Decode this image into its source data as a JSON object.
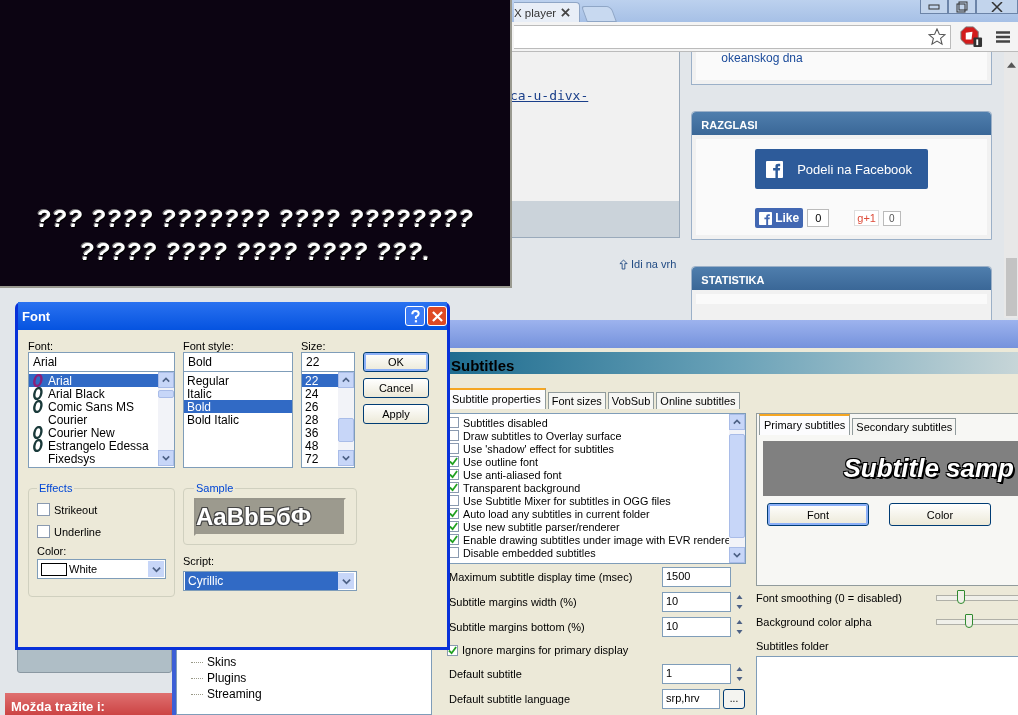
{
  "browser": {
    "tab": {
      "title": "X player"
    },
    "page": {
      "article_link": "ca-u-divx-",
      "related_link": "okeanskog dna",
      "back_to_top": "Idi na vrh",
      "razglasi": {
        "title": "RAZGLASI",
        "share_button": "Podeli na Facebook",
        "like": "Like",
        "like_count": "0",
        "plus_one": "g+1",
        "plus_one_count": "0"
      },
      "statistika": {
        "title": "STATISTIKA"
      },
      "suggestions": {
        "title": "Možda tražite i:"
      }
    }
  },
  "video": {
    "subtitle_lines": [
      "??? ???? ??????? ???? ????????",
      "????? ???? ???? ???? ???."
    ]
  },
  "options": {
    "tree": [
      {
        "label": "Skins"
      },
      {
        "label": "Plugins"
      },
      {
        "label": "Streaming"
      }
    ],
    "header": "Subtitles",
    "tabs": [
      {
        "label": "Subtitle properties",
        "selected": true
      },
      {
        "label": "Font sizes",
        "selected": false
      },
      {
        "label": "VobSub",
        "selected": false
      },
      {
        "label": "Online subtitles",
        "selected": false
      }
    ],
    "checkboxes": [
      {
        "label": "Subtitles disabled",
        "checked": false
      },
      {
        "label": "Draw subtitles to Overlay surface",
        "checked": false
      },
      {
        "label": "Use 'shadow' effect for subtitles",
        "checked": false
      },
      {
        "label": "Use outline font",
        "checked": true
      },
      {
        "label": "Use anti-aliased font",
        "checked": true
      },
      {
        "label": "Transparent background",
        "checked": true
      },
      {
        "label": "Use Subtitle Mixer for subtitles in OGG files",
        "checked": false
      },
      {
        "label": "Auto load any subtitles in current folder",
        "checked": true
      },
      {
        "label": "Use new subtitle parser/renderer",
        "checked": true
      },
      {
        "label": "Enable drawing subtitles under image with EVR rendere",
        "checked": true
      },
      {
        "label": "Disable embedded subtitles",
        "checked": false
      }
    ],
    "settings": [
      {
        "kind": "field",
        "label": "Maximum subtitle display time (msec)",
        "value": "1500"
      },
      {
        "kind": "spinner",
        "label": "Subtitle margins width (%)",
        "value": "10"
      },
      {
        "kind": "spinner",
        "label": "Subtitle margins bottom (%)",
        "value": "10"
      },
      {
        "kind": "checkbox",
        "label": "Ignore margins for primary display",
        "checked": true
      },
      {
        "kind": "spinner",
        "label": "Default subtitle",
        "value": "1"
      },
      {
        "kind": "browse",
        "label": "Default subtitle language",
        "value": "srp,hrv",
        "button": "..."
      }
    ],
    "subtitle_tabs": [
      {
        "label": "Primary subtitles",
        "selected": true
      },
      {
        "label": "Secondary subtitles",
        "selected": false
      }
    ],
    "preview": "Subtitle samp",
    "buttons": [
      "Font",
      "Color"
    ],
    "sliders": [
      {
        "label": "Font smoothing (0 = disabled)",
        "level": 0.28
      },
      {
        "label": "Background color alpha",
        "level": 0.38
      }
    ],
    "folder_label": "Subtitles folder"
  },
  "font_dialog": {
    "title": "Font",
    "font_label": "Font:",
    "font_value": "Arial",
    "fonts": [
      {
        "name": "Arial",
        "kind": "opentype",
        "selected": true
      },
      {
        "name": "Arial Black",
        "kind": "opentype",
        "selected": false
      },
      {
        "name": "Comic Sans MS",
        "kind": "opentype",
        "selected": false
      },
      {
        "name": "Courier",
        "kind": "raster",
        "selected": false
      },
      {
        "name": "Courier New",
        "kind": "opentype",
        "selected": false
      },
      {
        "name": "Estrangelo Edessa",
        "kind": "opentype",
        "selected": false
      },
      {
        "name": "Fixedsys",
        "kind": "raster",
        "selected": false
      }
    ],
    "style_label": "Font style:",
    "style_value": "Bold",
    "styles": [
      {
        "name": "Regular",
        "selected": false
      },
      {
        "name": "Italic",
        "selected": false
      },
      {
        "name": "Bold",
        "selected": true
      },
      {
        "name": "Bold Italic",
        "selected": false
      }
    ],
    "size_label": "Size:",
    "size_value": "22",
    "sizes": [
      {
        "name": "22",
        "selected": true
      },
      {
        "name": "24",
        "selected": false
      },
      {
        "name": "26",
        "selected": false
      },
      {
        "name": "28",
        "selected": false
      },
      {
        "name": "36",
        "selected": false
      },
      {
        "name": "48",
        "selected": false
      },
      {
        "name": "72",
        "selected": false
      }
    ],
    "buttons": [
      {
        "label": "OK",
        "default": true
      },
      {
        "label": "Cancel",
        "default": false
      },
      {
        "label": "Apply",
        "default": false
      }
    ],
    "effects_title": "Effects",
    "effects": [
      {
        "label": "Strikeout",
        "checked": false
      },
      {
        "label": "Underline",
        "checked": false
      }
    ],
    "color_label": "Color:",
    "color_value": "White",
    "color": "#ffffff",
    "sample_title": "Sample",
    "sample_text": "AaBbБбФ",
    "script_label": "Script:",
    "script_value": "Cyrillic"
  }
}
